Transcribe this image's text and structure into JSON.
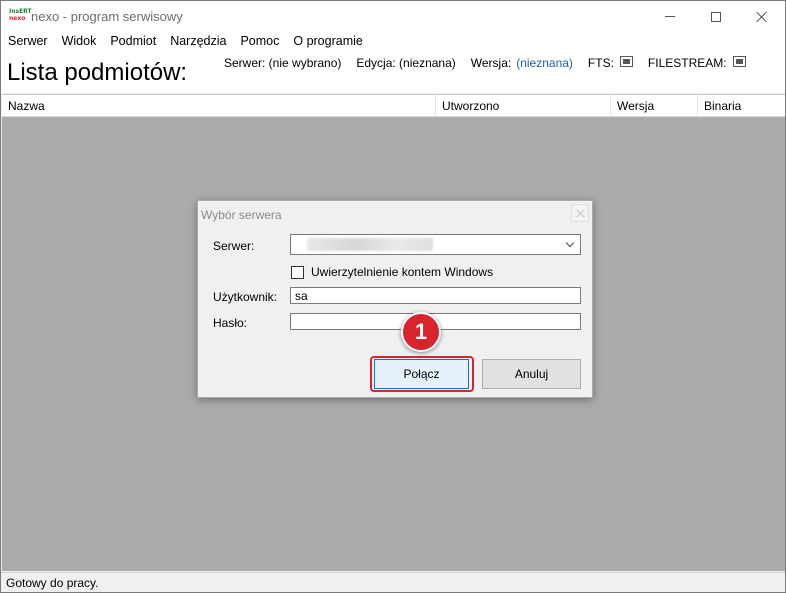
{
  "window": {
    "title": "nexo - program serwisowy",
    "logo_line1": "InsERT",
    "logo_line2": "nexo"
  },
  "menu": {
    "items": [
      "Serwer",
      "Widok",
      "Podmiot",
      "Narzędzia",
      "Pomoc",
      "O programie"
    ]
  },
  "header": {
    "page_title": "Lista podmiotów:",
    "server_label": "Serwer: (nie wybrano)",
    "edition_label": "Edycja: (nieznana)",
    "version_label": "Wersja:",
    "version_value": "(nieznana)",
    "fts_label": "FTS:",
    "filestream_label": "FILESTREAM:"
  },
  "grid": {
    "columns": [
      "Nazwa",
      "Utworzono",
      "Wersja",
      "Binaria"
    ]
  },
  "status": {
    "text": "Gotowy do pracy."
  },
  "dialog": {
    "title": "Wybór serwera",
    "server_label": "Serwer:",
    "windows_auth_label": "Uwierzytelnienie kontem Windows",
    "windows_auth_checked": false,
    "user_label": "Użytkownik:",
    "user_value": "sa",
    "password_label": "Hasło:",
    "connect_label": "Połącz",
    "cancel_label": "Anuluj"
  },
  "annotation": {
    "badge_number": "1",
    "color": "#d9232d"
  }
}
